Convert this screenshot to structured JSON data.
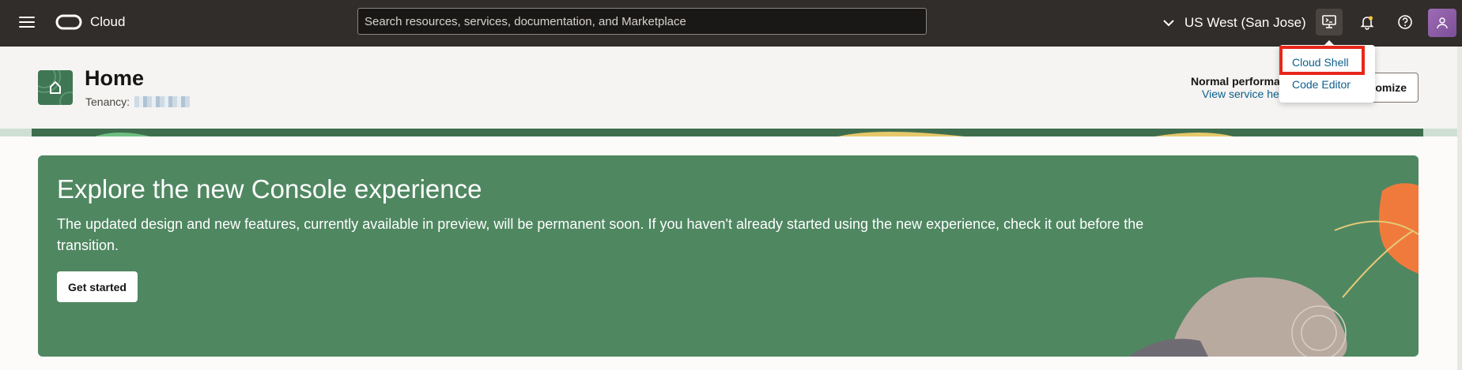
{
  "topbar": {
    "brand": "Cloud",
    "search_placeholder": "Search resources, services, documentation, and Marketplace",
    "region": "US West (San Jose)"
  },
  "icons": {
    "menu": "hamburger-icon",
    "logo": "oracle-logo",
    "region": "chevron-down-icon",
    "cloud_shell": "cloud-shell-icon",
    "notifications": "bell-icon",
    "help": "help-icon",
    "avatar": "user-icon",
    "home": "home-icon"
  },
  "dropdown": {
    "items": [
      {
        "label": "Cloud Shell"
      },
      {
        "label": "Code Editor"
      }
    ]
  },
  "header": {
    "title": "Home",
    "tenancy_label": "Tenancy:",
    "status": "Normal performan",
    "status_link": "View service hea",
    "customize_label": "omize"
  },
  "banner": {
    "title": "Explore the new Console experience",
    "body": "The updated design and new features, currently available in preview, will be permanent soon. If you haven't already started using the new experience, check it out before the transition.",
    "button_label": "Get started"
  },
  "colors": {
    "topbar": "#312d2a",
    "banner": "#4f8761",
    "link": "#0d5f8c",
    "highlight": "#e8271a",
    "avatar": "#8e5ca8"
  }
}
